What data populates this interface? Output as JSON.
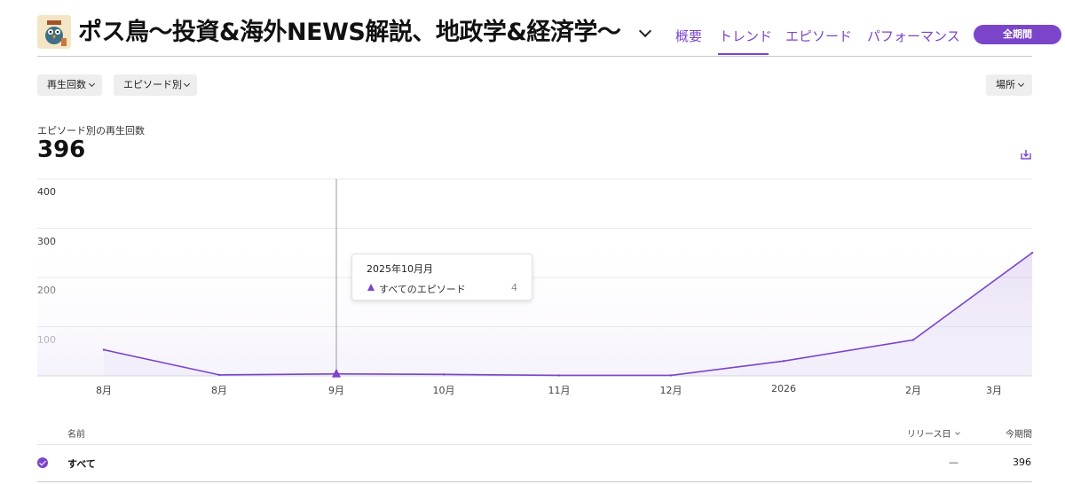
{
  "header": {
    "title": "ポス鳥〜投資&海外NEWS解説、地政学&経済学〜",
    "tabs": [
      {
        "label": "概要"
      },
      {
        "label": "トレンド"
      },
      {
        "label": "エピソード"
      },
      {
        "label": "パフォーマンス"
      }
    ],
    "active_tab": "トレンド",
    "period_button": "全期間"
  },
  "filters": {
    "metric": "再生回数",
    "grouping": "エピソード別",
    "location": "場所"
  },
  "summary": {
    "label": "エピソード別の再生回数",
    "value": "396"
  },
  "tooltip": {
    "date": "2025年10月月",
    "series": "すべてのエピソード",
    "value": "4"
  },
  "chart_data": {
    "type": "area",
    "categories": [
      "8月",
      "8月",
      "9月",
      "10月",
      "11月",
      "12月",
      "2026",
      "2月",
      "3月"
    ],
    "series": [
      {
        "name": "すべてのエピソード",
        "values": [
          53,
          2,
          4,
          3,
          1,
          1,
          30,
          73,
          250
        ]
      }
    ],
    "y_ticks": [
      "400",
      "300",
      "200",
      "100"
    ],
    "ylim": [
      0,
      400
    ],
    "grid": true,
    "accent_color": "#7a45c9"
  },
  "table": {
    "columns": [
      "名前",
      "リリース日",
      "今期間"
    ],
    "rows": [
      {
        "name": "すべて",
        "release": "—",
        "period": "396"
      }
    ]
  },
  "icons": {
    "download": "download-icon",
    "check": "check-icon"
  }
}
